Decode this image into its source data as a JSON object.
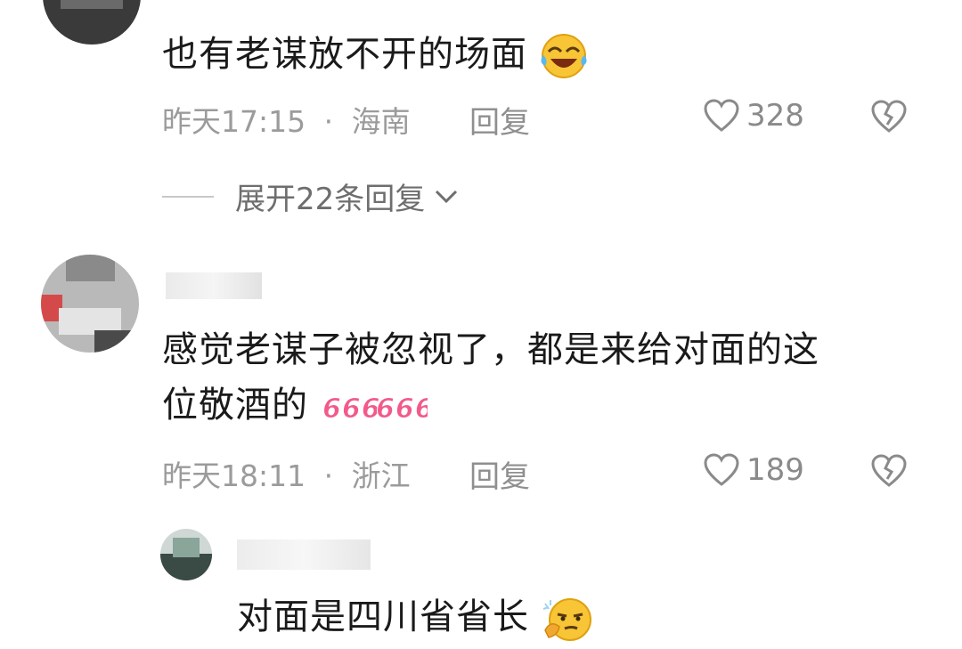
{
  "comments": [
    {
      "text": "也有老谋放不开的场面",
      "emoji": "face-with-tears-of-joy",
      "time": "昨天17:15",
      "location": "海南",
      "reply_label": "回复",
      "likes": "328",
      "expand_label": "展开22条回复"
    },
    {
      "line1": "感觉老谋子被忽视了，都是来给对面的这",
      "line2": "位敬酒的",
      "emoji": "666-666",
      "time": "昨天18:11",
      "location": "浙江",
      "reply_label": "回复",
      "likes": "189"
    }
  ],
  "reply": {
    "text": "对面是四川省省长",
    "emoji": "thinking-smirk-face"
  },
  "separator": "·"
}
